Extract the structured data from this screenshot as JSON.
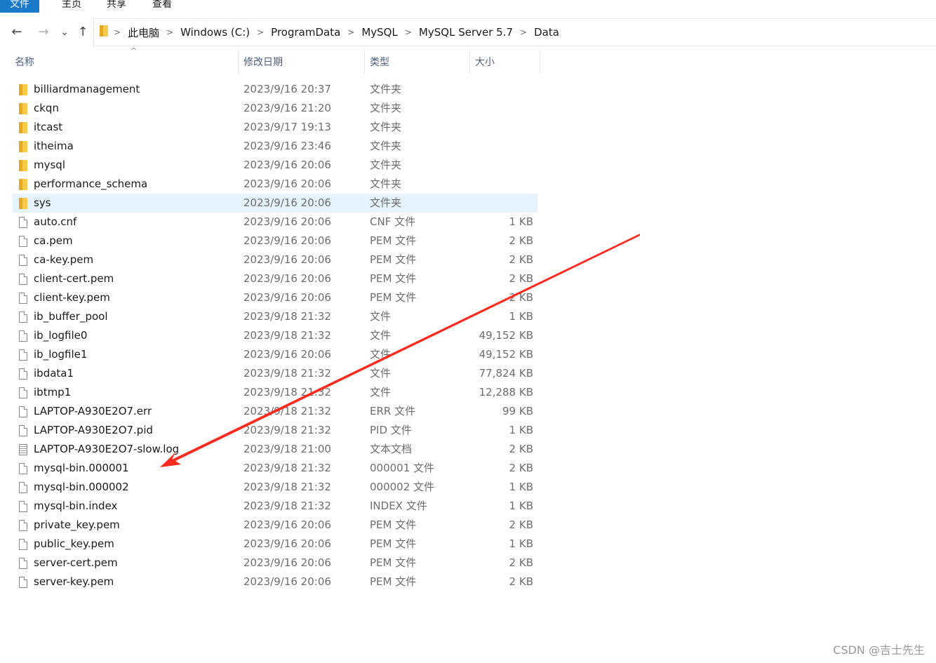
{
  "ribbon": {
    "tabs": [
      "文件",
      "主页",
      "共享",
      "查看"
    ]
  },
  "nav": {
    "back": "←",
    "forward": "→",
    "recent": "⌄",
    "up": "↑"
  },
  "breadcrumb": [
    "此电脑",
    "Windows (C:)",
    "ProgramData",
    "MySQL",
    "MySQL Server 5.7",
    "Data"
  ],
  "columns": {
    "name": "名称",
    "date": "修改日期",
    "type": "类型",
    "size": "大小"
  },
  "files": [
    {
      "name": "billiardmanagement",
      "date": "2023/9/16 20:37",
      "type": "文件夹",
      "size": "",
      "icon": "folder-icon"
    },
    {
      "name": "ckqn",
      "date": "2023/9/16 21:20",
      "type": "文件夹",
      "size": "",
      "icon": "folder-icon"
    },
    {
      "name": "itcast",
      "date": "2023/9/17 19:13",
      "type": "文件夹",
      "size": "",
      "icon": "folder-icon"
    },
    {
      "name": "itheima",
      "date": "2023/9/16 23:46",
      "type": "文件夹",
      "size": "",
      "icon": "folder-icon"
    },
    {
      "name": "mysql",
      "date": "2023/9/16 20:06",
      "type": "文件夹",
      "size": "",
      "icon": "folder-icon"
    },
    {
      "name": "performance_schema",
      "date": "2023/9/16 20:06",
      "type": "文件夹",
      "size": "",
      "icon": "folder-icon"
    },
    {
      "name": "sys",
      "date": "2023/9/16 20:06",
      "type": "文件夹",
      "size": "",
      "icon": "folder-icon",
      "selected": true
    },
    {
      "name": "auto.cnf",
      "date": "2023/9/16 20:06",
      "type": "CNF 文件",
      "size": "1 KB",
      "icon": "file-icon"
    },
    {
      "name": "ca.pem",
      "date": "2023/9/16 20:06",
      "type": "PEM 文件",
      "size": "2 KB",
      "icon": "file-icon"
    },
    {
      "name": "ca-key.pem",
      "date": "2023/9/16 20:06",
      "type": "PEM 文件",
      "size": "2 KB",
      "icon": "file-icon"
    },
    {
      "name": "client-cert.pem",
      "date": "2023/9/16 20:06",
      "type": "PEM 文件",
      "size": "2 KB",
      "icon": "file-icon"
    },
    {
      "name": "client-key.pem",
      "date": "2023/9/16 20:06",
      "type": "PEM 文件",
      "size": "2 KB",
      "icon": "file-icon"
    },
    {
      "name": "ib_buffer_pool",
      "date": "2023/9/18 21:32",
      "type": "文件",
      "size": "1 KB",
      "icon": "file-icon"
    },
    {
      "name": "ib_logfile0",
      "date": "2023/9/18 21:32",
      "type": "文件",
      "size": "49,152 KB",
      "icon": "file-icon"
    },
    {
      "name": "ib_logfile1",
      "date": "2023/9/16 20:06",
      "type": "文件",
      "size": "49,152 KB",
      "icon": "file-icon"
    },
    {
      "name": "ibdata1",
      "date": "2023/9/18 21:32",
      "type": "文件",
      "size": "77,824 KB",
      "icon": "file-icon"
    },
    {
      "name": "ibtmp1",
      "date": "2023/9/18 21:32",
      "type": "文件",
      "size": "12,288 KB",
      "icon": "file-icon"
    },
    {
      "name": "LAPTOP-A930E2O7.err",
      "date": "2023/9/18 21:32",
      "type": "ERR 文件",
      "size": "99 KB",
      "icon": "file-icon"
    },
    {
      "name": "LAPTOP-A930E2O7.pid",
      "date": "2023/9/18 21:32",
      "type": "PID 文件",
      "size": "1 KB",
      "icon": "file-icon"
    },
    {
      "name": "LAPTOP-A930E2O7-slow.log",
      "date": "2023/9/18 21:00",
      "type": "文本文档",
      "size": "2 KB",
      "icon": "text-file-icon"
    },
    {
      "name": "mysql-bin.000001",
      "date": "2023/9/18 21:32",
      "type": "000001 文件",
      "size": "2 KB",
      "icon": "file-icon"
    },
    {
      "name": "mysql-bin.000002",
      "date": "2023/9/18 21:32",
      "type": "000002 文件",
      "size": "1 KB",
      "icon": "file-icon"
    },
    {
      "name": "mysql-bin.index",
      "date": "2023/9/18 21:32",
      "type": "INDEX 文件",
      "size": "1 KB",
      "icon": "file-icon"
    },
    {
      "name": "private_key.pem",
      "date": "2023/9/16 20:06",
      "type": "PEM 文件",
      "size": "2 KB",
      "icon": "file-icon"
    },
    {
      "name": "public_key.pem",
      "date": "2023/9/16 20:06",
      "type": "PEM 文件",
      "size": "1 KB",
      "icon": "file-icon"
    },
    {
      "name": "server-cert.pem",
      "date": "2023/9/16 20:06",
      "type": "PEM 文件",
      "size": "2 KB",
      "icon": "file-icon"
    },
    {
      "name": "server-key.pem",
      "date": "2023/9/16 20:06",
      "type": "PEM 文件",
      "size": "2 KB",
      "icon": "file-icon"
    }
  ],
  "annotation": {
    "arrow_color": "#ff2a1f"
  },
  "watermark": "CSDN @吉士先生",
  "colors": {
    "ribbon_active": "#1979ca",
    "selection": "#e5f3ff",
    "header_text": "#4d6082",
    "folder": "#f8c94a"
  }
}
